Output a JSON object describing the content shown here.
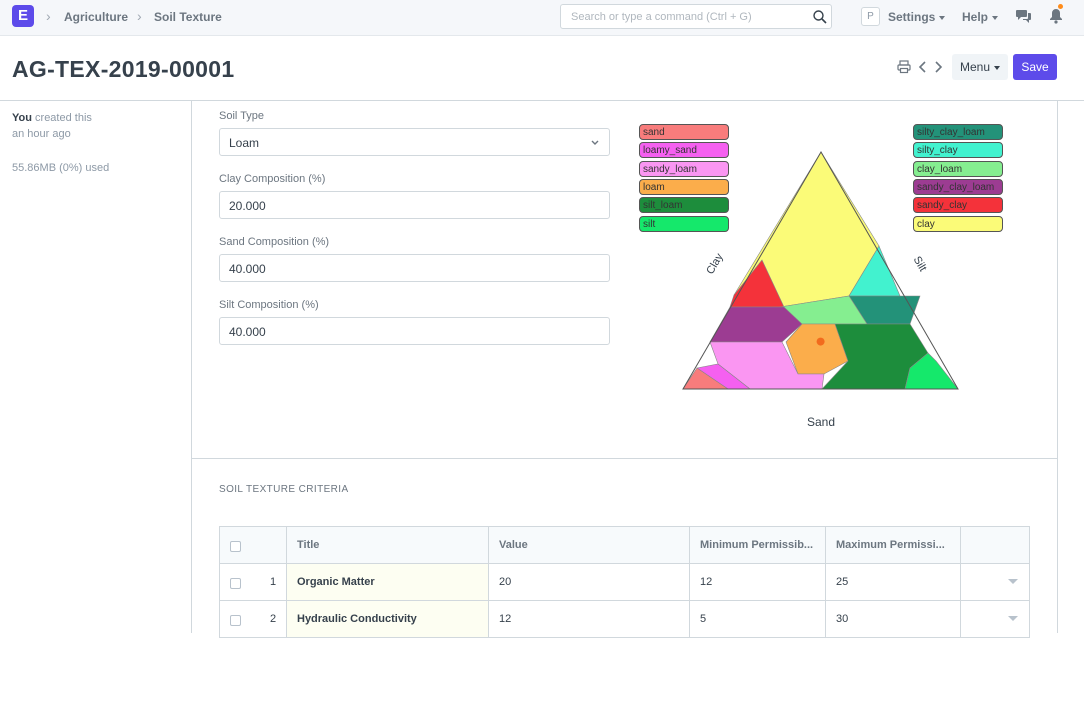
{
  "navbar": {
    "logo_letter": "E",
    "breadcrumbs": [
      "Agriculture",
      "Soil Texture"
    ],
    "search_placeholder": "Search or type a command (Ctrl + G)",
    "avatar_letter": "P",
    "settings_label": "Settings",
    "help_label": "Help"
  },
  "page": {
    "title": "AG-TEX-2019-00001",
    "menu_label": "Menu",
    "save_label": "Save"
  },
  "sidebar": {
    "creator": "You",
    "created_text": "created this",
    "created_when": "an hour ago",
    "usage": "55.86MB (0%) used"
  },
  "form": {
    "soil_type_label": "Soil Type",
    "soil_type_value": "Loam",
    "clay_label": "Clay Composition (%)",
    "clay_value": "20.000",
    "sand_label": "Sand Composition (%)",
    "sand_value": "40.000",
    "silt_label": "Silt Composition (%)",
    "silt_value": "40.000"
  },
  "ternary": {
    "axis_clay": "Clay",
    "axis_silt": "Silt",
    "axis_sand": "Sand",
    "legend_left": [
      {
        "label": "sand",
        "color": "#f87c7c"
      },
      {
        "label": "loamy_sand",
        "color": "#f560f0"
      },
      {
        "label": "sandy_loam",
        "color": "#fa96f2"
      },
      {
        "label": "loam",
        "color": "#fbad4b"
      },
      {
        "label": "silt_loam",
        "color": "#1d8d3c"
      },
      {
        "label": "silt",
        "color": "#15e86b"
      }
    ],
    "legend_right": [
      {
        "label": "silty_clay_loam",
        "color": "#239279"
      },
      {
        "label": "silty_clay",
        "color": "#42f2cf"
      },
      {
        "label": "clay_loam",
        "color": "#85ee90"
      },
      {
        "label": "sandy_clay_loam",
        "color": "#9c3c92"
      },
      {
        "label": "sandy_clay",
        "color": "#f4323a"
      },
      {
        "label": "clay",
        "color": "#fbfb78"
      }
    ],
    "point": {
      "clay": 20,
      "sand": 40,
      "silt": 40,
      "color": "#f26b1d"
    }
  },
  "criteria": {
    "section_title": "SOIL TEXTURE CRITERIA",
    "columns": [
      "Title",
      "Value",
      "Minimum Permissib...",
      "Maximum Permissi..."
    ],
    "rows": [
      {
        "idx": "1",
        "title": "Organic Matter",
        "value": "20",
        "min": "12",
        "max": "25"
      },
      {
        "idx": "2",
        "title": "Hydraulic Conductivity",
        "value": "12",
        "min": "5",
        "max": "30"
      }
    ]
  }
}
